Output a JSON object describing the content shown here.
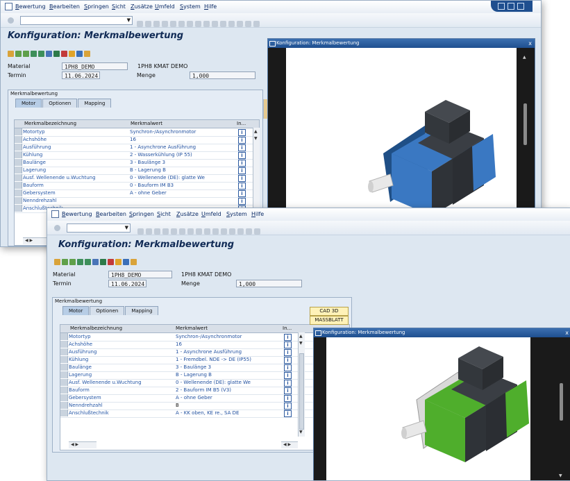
{
  "menu": [
    "Bewertung",
    "Bearbeiten",
    "Springen",
    "Sicht",
    "Zusätze",
    "Umfeld",
    "System",
    "Hilfe"
  ],
  "title": "Konfiguration: Merkmalbewertung",
  "material_label": "Material",
  "material_value": "1PH8_DEMO",
  "material_desc": "1PH8 KMAT DEMO",
  "termin_label": "Termin",
  "termin_value": "11.06.2024",
  "menge_label": "Menge",
  "menge_value": "1,000",
  "group_title": "Merkmalbewertung",
  "tabs": [
    "Motor",
    "Optionen",
    "Mapping"
  ],
  "grid_headers": {
    "name": "Merkmalbezeichnung",
    "value": "Merkmalwert",
    "info": "In..."
  },
  "info_glyph": "i",
  "buttons": {
    "cad": "CAD 3D",
    "massblatt": "MASSBLATT"
  },
  "viewer_title": "Konfiguration: Merkmalbewertung",
  "viewer_close": "x",
  "window1": {
    "rows": [
      {
        "name": "Motortyp",
        "value": "Synchron-/Asynchronmotor"
      },
      {
        "name": "Achshöhe",
        "value": "16"
      },
      {
        "name": "Ausführung",
        "value": "1 - Asynchrone Ausführung"
      },
      {
        "name": "Kühlung",
        "value": "2 - Wasserkühlung (IP 55)"
      },
      {
        "name": "Baulänge",
        "value": "3 - Baulänge 3"
      },
      {
        "name": "Lagerung",
        "value": "B - Lagerung B"
      },
      {
        "name": "Ausf. Wellenende u.Wuchtung",
        "value": "0 - Wellenende (DE): glatte We"
      },
      {
        "name": "Bauform",
        "value": "0 - Bauform IM B3"
      },
      {
        "name": "Gebersystem",
        "value": "A - ohne Geber"
      },
      {
        "name": "Nenndrehzahl",
        "value": ""
      },
      {
        "name": "Anschlußtechnik",
        "value": ""
      }
    ],
    "motor_color": "#3a78c2"
  },
  "window2": {
    "rows": [
      {
        "name": "Motortyp",
        "value": "Synchron-/Asynchronmotor"
      },
      {
        "name": "Achshöhe",
        "value": "16"
      },
      {
        "name": "Ausführung",
        "value": "1 - Asynchrone Ausführung"
      },
      {
        "name": "Kühlung",
        "value": "1 - Fremdbel. NDE -> DE (IP55)"
      },
      {
        "name": "Baulänge",
        "value": "3 - Baulänge 3"
      },
      {
        "name": "Lagerung",
        "value": "B - Lagerung B"
      },
      {
        "name": "Ausf. Wellenende u.Wuchtung",
        "value": "0 - Wellenende (DE): glatte We"
      },
      {
        "name": "Bauform",
        "value": "2 - Bauform IM B5 (V3)"
      },
      {
        "name": "Gebersystem",
        "value": "A - ohne Geber"
      },
      {
        "name": "Nenndrehzahl",
        "value": "B"
      },
      {
        "name": "Anschlußtechnik",
        "value": "A - KK oben, KE re., SA DE"
      }
    ],
    "motor_color": "#4fae2c"
  }
}
